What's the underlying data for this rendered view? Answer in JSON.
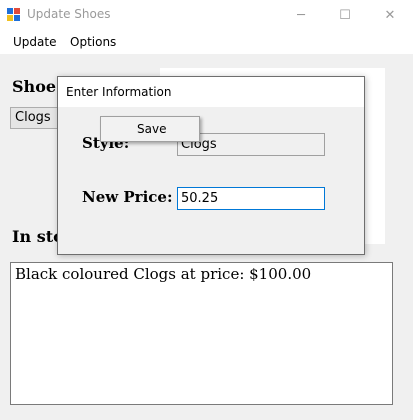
{
  "window": {
    "title": "Update Shoes",
    "controls": {
      "minimize": "─",
      "maximize": "☐",
      "close": "✕"
    }
  },
  "menu": {
    "items": [
      "Update",
      "Options"
    ]
  },
  "form": {
    "shoe_label": "Shoe",
    "shoe_combo_value": "Clogs",
    "in_stock_label": "In sto",
    "output_text": "Black coloured Clogs at price: $100.00"
  },
  "dialog": {
    "title": "Enter Information",
    "style_label": "Style:",
    "style_value": "Clogs",
    "price_label": "New Price:",
    "price_value": "50.25"
  },
  "context_menu": {
    "items": [
      "Save"
    ]
  },
  "colors": {
    "focus_border": "#0078d7",
    "window_bg": "#f0f0f0"
  },
  "icons": {
    "app": "app-window-icon"
  }
}
